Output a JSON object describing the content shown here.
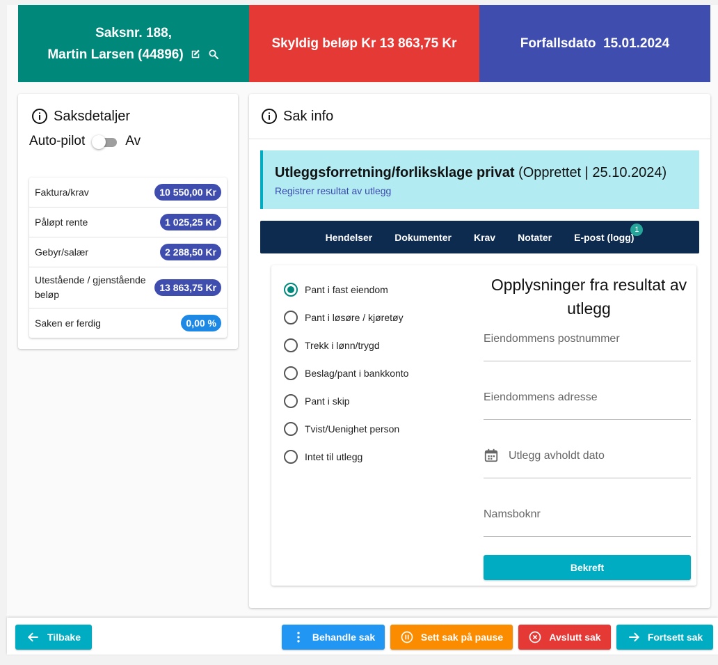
{
  "header": {
    "case_line": "Saksnr. 188,",
    "debtor_line": "Martin Larsen (44896)",
    "amount_due": "Skyldig beløp Kr 13 863,75 Kr",
    "due_date": "Forfallsdato  15.01.2024",
    "colors": {
      "green": "#00897b",
      "red": "#e53935",
      "blue": "#3f4eae"
    },
    "icons": [
      "edit-icon",
      "search-icon"
    ]
  },
  "case_details": {
    "title": "Saksdetaljer",
    "autopilot_label": "Auto-pilot",
    "autopilot_state": "Av",
    "autopilot_on": false,
    "rows": [
      {
        "label": "Faktura/krav",
        "value": "10 550,00 Kr"
      },
      {
        "label": "Påløpt rente",
        "value": "1 025,25 Kr"
      },
      {
        "label": "Gebyr/salær",
        "value": "2 288,50 Kr"
      },
      {
        "label": "Utestående / gjenstående beløp",
        "value": "13 863,75 Kr"
      },
      {
        "label": "Saken er ferdig",
        "value": "0,00 %"
      }
    ]
  },
  "case_info": {
    "title": "Sak info",
    "banner": {
      "title": "Utleggsforretning/forliksklage privat",
      "status": "(Opprettet | 25.10.2024)",
      "link": "Registrer resultat av utlegg"
    },
    "tabs": [
      {
        "label": "Hendelser"
      },
      {
        "label": "Dokumenter"
      },
      {
        "label": "Krav"
      },
      {
        "label": "Notater"
      },
      {
        "label": "E-post (logg)",
        "badge": "1"
      }
    ],
    "options": [
      {
        "label": "Pant i fast eiendom",
        "selected": true
      },
      {
        "label": "Pant i løsøre / kjøretøy",
        "selected": false
      },
      {
        "label": "Trekk i lønn/trygd",
        "selected": false
      },
      {
        "label": "Beslag/pant i bankkonto",
        "selected": false
      },
      {
        "label": "Pant i skip",
        "selected": false
      },
      {
        "label": "Tvist/Uenighet person",
        "selected": false
      },
      {
        "label": "Intet til utlegg",
        "selected": false
      }
    ],
    "form": {
      "title": "Opplysninger fra resultat av utlegg",
      "postcode_placeholder": "Eiendommens postnummer",
      "address_placeholder": "Eiendommens adresse",
      "date_placeholder": "Utlegg avholdt dato",
      "ref_placeholder": "Namsboknr",
      "confirm_label": "Bekreft"
    }
  },
  "footer": {
    "back_label": "Tilbake",
    "handle_label": "Behandle sak",
    "pause_label": "Sett sak på pause",
    "close_label": "Avslutt sak",
    "continue_label": "Fortsett sak",
    "colors": {
      "cyan": "#00acc1",
      "blue": "#2196f3",
      "orange": "#fb8c00",
      "red": "#e53935"
    }
  }
}
